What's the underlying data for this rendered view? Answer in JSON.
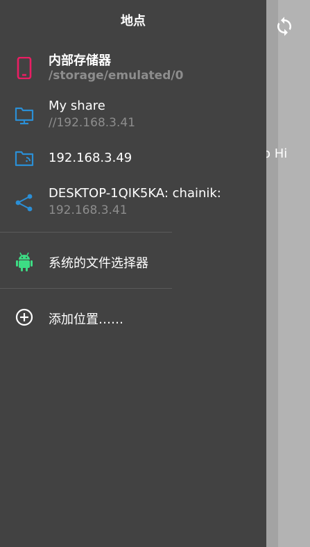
{
  "drawer": {
    "title": "地点",
    "items": [
      {
        "label": "内部存储器",
        "sub": "/storage/emulated/0",
        "icon": "phone-icon",
        "color": "#e91e63"
      },
      {
        "label": "My share",
        "sub": "//192.168.3.41",
        "icon": "desktop-folder-icon",
        "color": "#2b8fd6"
      },
      {
        "label": "192.168.3.49",
        "sub": "",
        "icon": "network-folder-icon",
        "color": "#2b8fd6"
      },
      {
        "label": "DESKTOP-1QIK5KA: chainik:",
        "sub": "192.168.3.41",
        "icon": "share-icon",
        "color": "#2b8fd6"
      },
      {
        "label": "系统的文件选择器",
        "sub": "",
        "icon": "android-icon",
        "color": "#3ddc84"
      },
      {
        "label": "添加位置……",
        "sub": "",
        "icon": "add-circle-icon",
        "color": "#ffffff"
      }
    ]
  },
  "background": {
    "partial_text": "o Hi",
    "refresh_icon": "refresh-icon"
  }
}
